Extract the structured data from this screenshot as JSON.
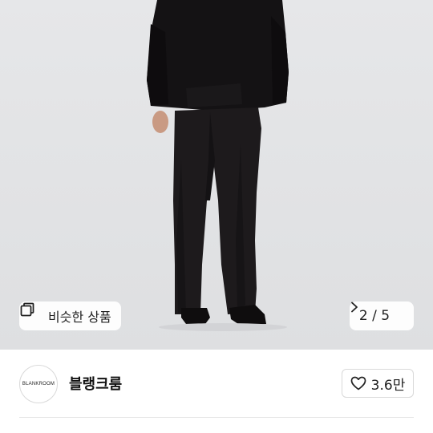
{
  "product": {
    "similar_label": "비슷한 상품",
    "similar_icon": "similar-items-icon",
    "pager_text": "2 / 5",
    "pager_icon": "chevron-right-icon"
  },
  "shop": {
    "avatar_text": "BLANKROOM",
    "name": "블랭크룸",
    "like_icon": "heart-outline-icon",
    "like_count": "3.6만"
  },
  "colors": {
    "background": "#ffffff",
    "photo_background": "#e4e5e7",
    "text": "#222222",
    "border": "#d9d9d9"
  }
}
